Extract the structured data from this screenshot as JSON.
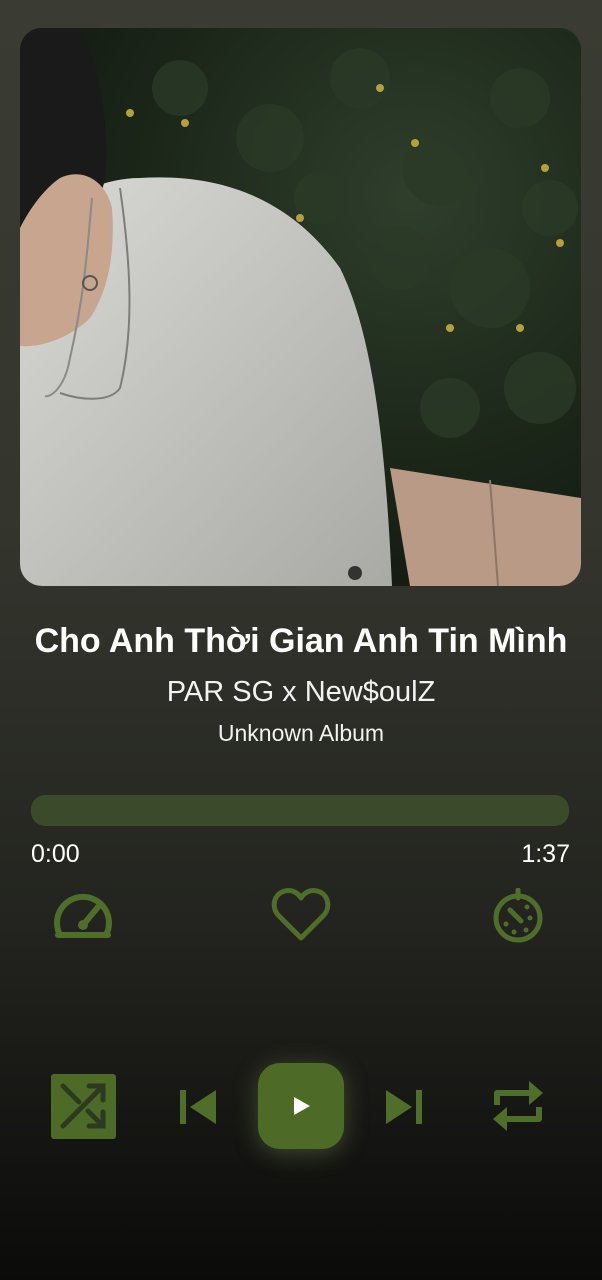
{
  "now_playing": {
    "title": "Cho Anh Thời Gian Anh Tin Mình",
    "artist": "PAR SG x New$oulZ",
    "album": "Unknown Album"
  },
  "playback": {
    "elapsed": "0:00",
    "duration": "1:37",
    "progress": 0
  },
  "colors": {
    "accent": "#4d6b27",
    "icon": "#4e6e2a",
    "track": "#3a4a2a",
    "background_top": "#3a3c33",
    "background_bottom": "#0b0b0a"
  },
  "icons": {
    "speed": "speedometer-icon",
    "favorite": "heart-outline-icon",
    "timer": "sleep-timer-icon",
    "shuffle": "shuffle-icon",
    "previous": "skip-previous-icon",
    "play": "play-icon",
    "next": "skip-next-icon",
    "repeat": "repeat-icon"
  }
}
